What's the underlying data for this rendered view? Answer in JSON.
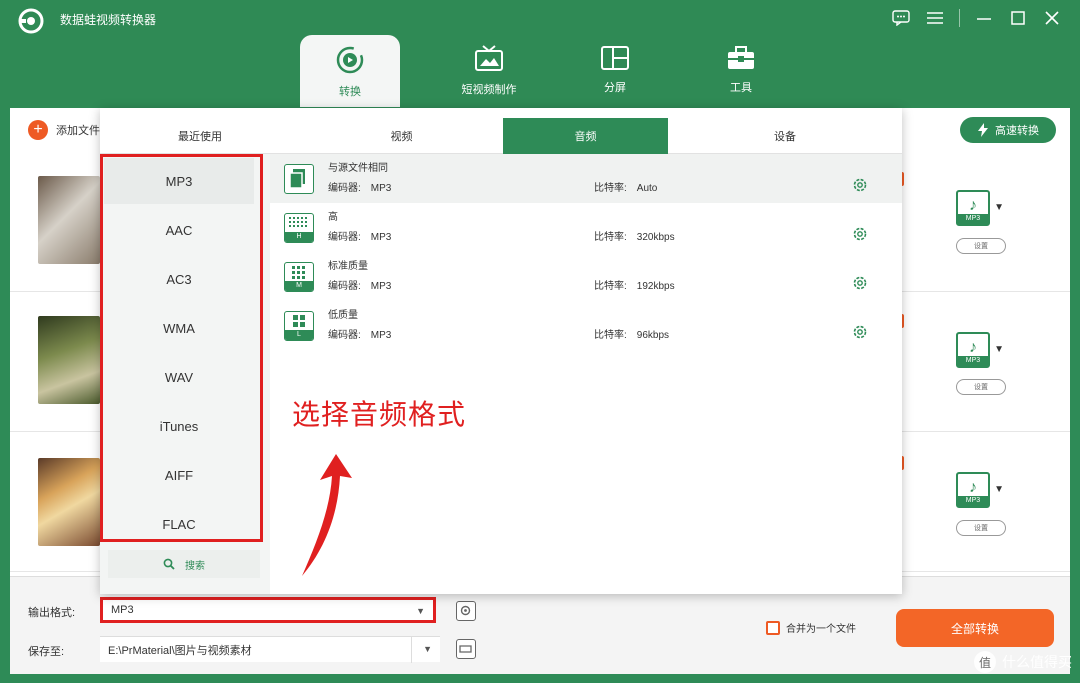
{
  "app": {
    "title": "数据蛙视频转换器"
  },
  "nav": {
    "tabs": [
      {
        "label": "转换",
        "active": true
      },
      {
        "label": "短视频制作"
      },
      {
        "label": "分屏"
      },
      {
        "label": "工具"
      }
    ]
  },
  "toolbar": {
    "add_file": "添加文件",
    "fast_convert": "高速转换"
  },
  "file_rows": [
    {
      "format": "MP3",
      "setting": "设置"
    },
    {
      "format": "MP3",
      "setting": "设置"
    },
    {
      "format": "MP3",
      "setting": "设置"
    }
  ],
  "format_popup": {
    "tabs": [
      "最近使用",
      "视频",
      "音频",
      "设备"
    ],
    "active_tab": "音频",
    "categories": [
      "MP3",
      "AAC",
      "AC3",
      "WMA",
      "WAV",
      "iTunes",
      "AIFF",
      "FLAC"
    ],
    "search_label": "搜索",
    "codec_label": "编码器:",
    "bitrate_label": "比特率:",
    "qualities": [
      {
        "name": "与源文件相同",
        "badge": "",
        "codec": "MP3",
        "bitrate": "Auto"
      },
      {
        "name": "高",
        "badge": "H",
        "codec": "MP3",
        "bitrate": "320kbps"
      },
      {
        "name": "标准质量",
        "badge": "M",
        "codec": "MP3",
        "bitrate": "192kbps"
      },
      {
        "name": "低质量",
        "badge": "L",
        "codec": "MP3",
        "bitrate": "96kbps"
      }
    ]
  },
  "annotation": "选择音频格式",
  "bottom": {
    "output_label": "输出格式:",
    "output_value": "MP3",
    "save_label": "保存至:",
    "save_value": "E:\\PrMaterial\\图片与视频素材",
    "merge_label": "合并为一个文件",
    "convert_all": "全部转换"
  },
  "watermark": {
    "icon_text": "值",
    "text": "什么值得买"
  },
  "colors": {
    "brand_green": "#2e8b57",
    "accent_orange": "#f36627",
    "annotation_red": "#e02020"
  }
}
